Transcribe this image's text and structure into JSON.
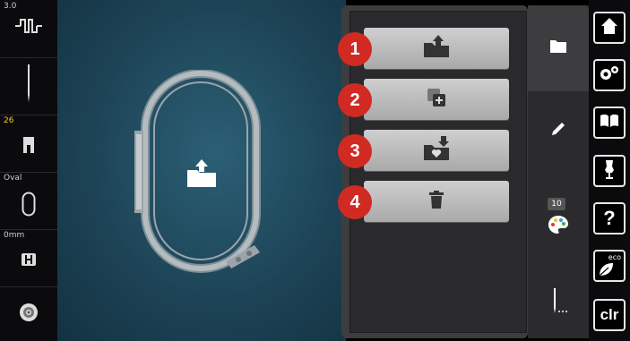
{
  "left_bar": {
    "stitch_width": "3.0",
    "presser_foot_number": "26",
    "hoop_label": "Oval",
    "feed_dog_label": "0mm"
  },
  "actions": [
    {
      "number": "1",
      "icon": "folder-export-icon"
    },
    {
      "number": "2",
      "icon": "duplicate-icon"
    },
    {
      "number": "3",
      "icon": "save-favorite-icon"
    },
    {
      "number": "4",
      "icon": "trash-icon"
    }
  ],
  "tabs": {
    "color_count": "10"
  },
  "right_bar": {
    "clr_label": "clr",
    "help_label": "?",
    "eco_label": "eco"
  },
  "colors": {
    "badge_red": "#d02a23",
    "canvas_blue": "#2c5f76",
    "accent_yellow": "#f4d21b"
  }
}
